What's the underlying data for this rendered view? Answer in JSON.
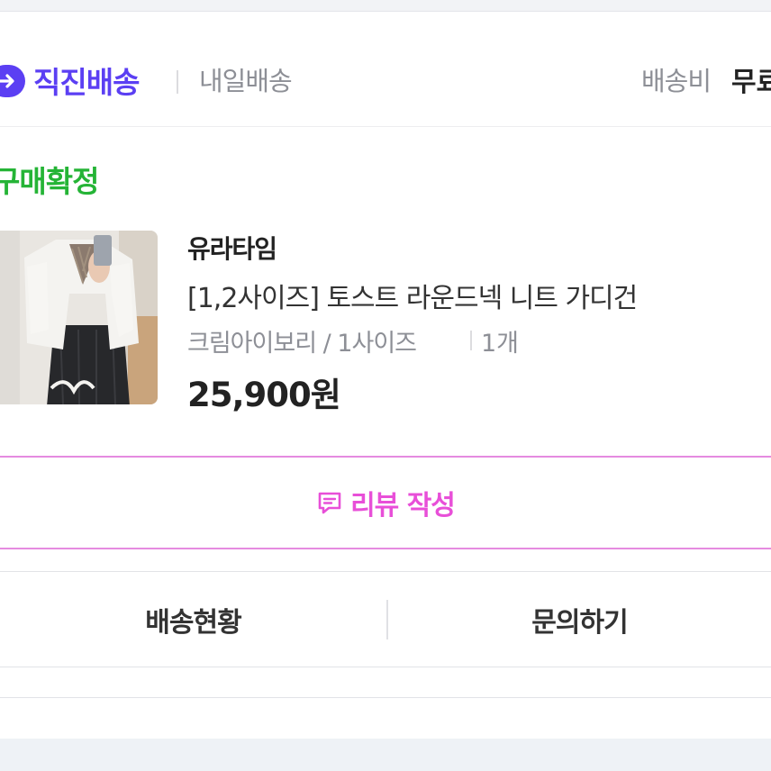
{
  "delivery": {
    "badge_title": "직진배송",
    "tomorrow_label": "내일배송",
    "fee_label": "배송비",
    "fee_value": "무료",
    "brand_color": "#5b3ff3",
    "icon": "arrow-right-circle-icon"
  },
  "order": {
    "status": "구매확정",
    "status_color": "#25b436",
    "item": {
      "shop_name": "유라타임",
      "product_name": "[1,2사이즈] 토스트 라운드넥 니트 가디건",
      "option": "크림아이보리 / 1사이즈",
      "quantity": "1개",
      "price": "25,900원",
      "thumbnail": "product-photo-cardigan"
    }
  },
  "actions": {
    "review_label": "리뷰 작성",
    "review_icon": "message-edit-icon",
    "review_color": "#e84fd8",
    "shipping_status_label": "배송현황",
    "inquiry_label": "문의하기"
  }
}
